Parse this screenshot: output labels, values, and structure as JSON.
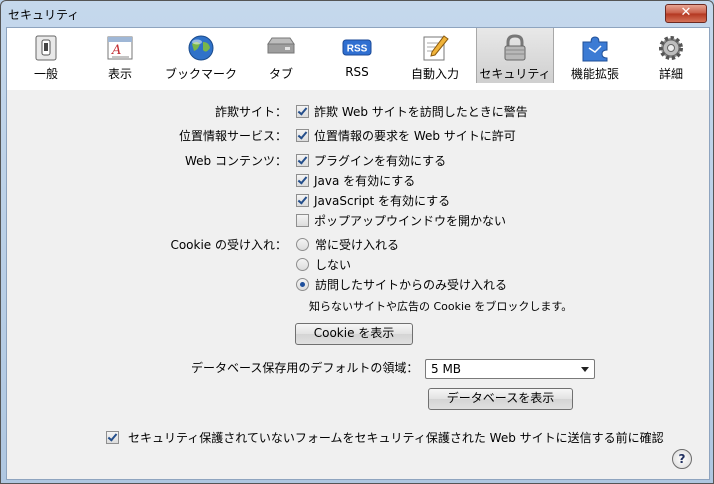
{
  "window": {
    "title": "セキュリティ",
    "close_symbol": "✕"
  },
  "toolbar": {
    "items": [
      {
        "label": "一般",
        "icon": "switch-icon"
      },
      {
        "label": "表示",
        "icon": "font-icon"
      },
      {
        "label": "ブックマーク",
        "icon": "globe-icon"
      },
      {
        "label": "タブ",
        "icon": "tabs-icon"
      },
      {
        "label": "RSS",
        "icon": "rss-icon",
        "icon_text": "RSS"
      },
      {
        "label": "自動入力",
        "icon": "pencil-form-icon"
      },
      {
        "label": "セキュリティ",
        "icon": "lock-icon",
        "selected": true
      },
      {
        "label": "機能拡張",
        "icon": "puzzle-icon"
      },
      {
        "label": "詳細",
        "icon": "gear-icon"
      }
    ]
  },
  "fraud": {
    "label": "詐欺サイト：",
    "option": "詐欺 Web サイトを訪問したときに警告",
    "checked": true
  },
  "location": {
    "label": "位置情報サービス：",
    "option": "位置情報の要求を Web サイトに許可",
    "checked": true
  },
  "web_content": {
    "label": "Web コンテンツ：",
    "options": [
      {
        "text": "プラグインを有効にする",
        "checked": true
      },
      {
        "text": "Java を有効にする",
        "checked": true
      },
      {
        "text": "JavaScript を有効にする",
        "checked": true
      },
      {
        "text": "ポップアップウインドウを開かない",
        "checked": false
      }
    ]
  },
  "cookies": {
    "label": "Cookie の受け入れ：",
    "options": [
      {
        "text": "常に受け入れる",
        "selected": false
      },
      {
        "text": "しない",
        "selected": false
      },
      {
        "text": "訪問したサイトからのみ受け入れる",
        "selected": true
      }
    ],
    "note": "知らないサイトや広告の Cookie をブロックします。",
    "show_button": "Cookie を表示"
  },
  "database": {
    "label": "データベース保存用のデフォルトの領域：",
    "value": "5 MB",
    "show_button": "データベースを表示"
  },
  "insecure_form": {
    "text": "セキュリティ保護されていないフォームをセキュリティ保護された Web サイトに送信する前に確認",
    "checked": true
  },
  "help": {
    "symbol": "?"
  }
}
